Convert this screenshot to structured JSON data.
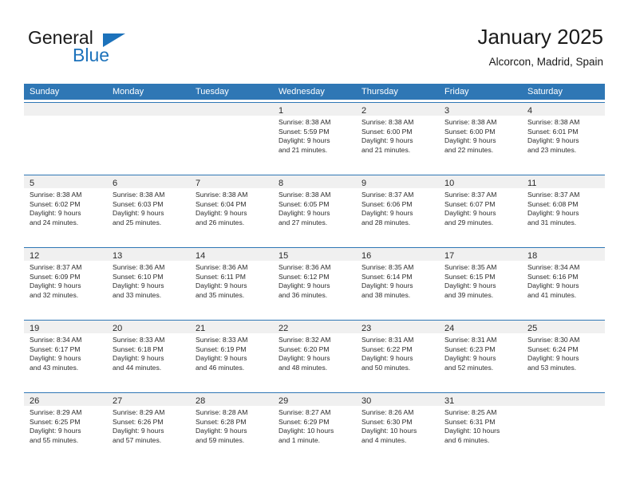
{
  "brand": {
    "word_one": "General",
    "word_two": "Blue",
    "flag_icon": "triangle-flag-icon"
  },
  "header": {
    "title": "January 2025",
    "location": "Alcorcon, Madrid, Spain"
  },
  "colors": {
    "header_blue": "#2f77b5",
    "brand_blue": "#1c72bb",
    "daynum_band": "#f0f0f0",
    "text": "#2b2b2b"
  },
  "calendar": {
    "day_headers": [
      "Sunday",
      "Monday",
      "Tuesday",
      "Wednesday",
      "Thursday",
      "Friday",
      "Saturday"
    ],
    "weeks": [
      [
        {
          "empty": true
        },
        {
          "empty": true
        },
        {
          "empty": true
        },
        {
          "day": "1",
          "sunrise": "Sunrise: 8:38 AM",
          "sunset": "Sunset: 5:59 PM",
          "daylight1": "Daylight: 9 hours",
          "daylight2": "and 21 minutes."
        },
        {
          "day": "2",
          "sunrise": "Sunrise: 8:38 AM",
          "sunset": "Sunset: 6:00 PM",
          "daylight1": "Daylight: 9 hours",
          "daylight2": "and 21 minutes."
        },
        {
          "day": "3",
          "sunrise": "Sunrise: 8:38 AM",
          "sunset": "Sunset: 6:00 PM",
          "daylight1": "Daylight: 9 hours",
          "daylight2": "and 22 minutes."
        },
        {
          "day": "4",
          "sunrise": "Sunrise: 8:38 AM",
          "sunset": "Sunset: 6:01 PM",
          "daylight1": "Daylight: 9 hours",
          "daylight2": "and 23 minutes."
        }
      ],
      [
        {
          "day": "5",
          "sunrise": "Sunrise: 8:38 AM",
          "sunset": "Sunset: 6:02 PM",
          "daylight1": "Daylight: 9 hours",
          "daylight2": "and 24 minutes."
        },
        {
          "day": "6",
          "sunrise": "Sunrise: 8:38 AM",
          "sunset": "Sunset: 6:03 PM",
          "daylight1": "Daylight: 9 hours",
          "daylight2": "and 25 minutes."
        },
        {
          "day": "7",
          "sunrise": "Sunrise: 8:38 AM",
          "sunset": "Sunset: 6:04 PM",
          "daylight1": "Daylight: 9 hours",
          "daylight2": "and 26 minutes."
        },
        {
          "day": "8",
          "sunrise": "Sunrise: 8:38 AM",
          "sunset": "Sunset: 6:05 PM",
          "daylight1": "Daylight: 9 hours",
          "daylight2": "and 27 minutes."
        },
        {
          "day": "9",
          "sunrise": "Sunrise: 8:37 AM",
          "sunset": "Sunset: 6:06 PM",
          "daylight1": "Daylight: 9 hours",
          "daylight2": "and 28 minutes."
        },
        {
          "day": "10",
          "sunrise": "Sunrise: 8:37 AM",
          "sunset": "Sunset: 6:07 PM",
          "daylight1": "Daylight: 9 hours",
          "daylight2": "and 29 minutes."
        },
        {
          "day": "11",
          "sunrise": "Sunrise: 8:37 AM",
          "sunset": "Sunset: 6:08 PM",
          "daylight1": "Daylight: 9 hours",
          "daylight2": "and 31 minutes."
        }
      ],
      [
        {
          "day": "12",
          "sunrise": "Sunrise: 8:37 AM",
          "sunset": "Sunset: 6:09 PM",
          "daylight1": "Daylight: 9 hours",
          "daylight2": "and 32 minutes."
        },
        {
          "day": "13",
          "sunrise": "Sunrise: 8:36 AM",
          "sunset": "Sunset: 6:10 PM",
          "daylight1": "Daylight: 9 hours",
          "daylight2": "and 33 minutes."
        },
        {
          "day": "14",
          "sunrise": "Sunrise: 8:36 AM",
          "sunset": "Sunset: 6:11 PM",
          "daylight1": "Daylight: 9 hours",
          "daylight2": "and 35 minutes."
        },
        {
          "day": "15",
          "sunrise": "Sunrise: 8:36 AM",
          "sunset": "Sunset: 6:12 PM",
          "daylight1": "Daylight: 9 hours",
          "daylight2": "and 36 minutes."
        },
        {
          "day": "16",
          "sunrise": "Sunrise: 8:35 AM",
          "sunset": "Sunset: 6:14 PM",
          "daylight1": "Daylight: 9 hours",
          "daylight2": "and 38 minutes."
        },
        {
          "day": "17",
          "sunrise": "Sunrise: 8:35 AM",
          "sunset": "Sunset: 6:15 PM",
          "daylight1": "Daylight: 9 hours",
          "daylight2": "and 39 minutes."
        },
        {
          "day": "18",
          "sunrise": "Sunrise: 8:34 AM",
          "sunset": "Sunset: 6:16 PM",
          "daylight1": "Daylight: 9 hours",
          "daylight2": "and 41 minutes."
        }
      ],
      [
        {
          "day": "19",
          "sunrise": "Sunrise: 8:34 AM",
          "sunset": "Sunset: 6:17 PM",
          "daylight1": "Daylight: 9 hours",
          "daylight2": "and 43 minutes."
        },
        {
          "day": "20",
          "sunrise": "Sunrise: 8:33 AM",
          "sunset": "Sunset: 6:18 PM",
          "daylight1": "Daylight: 9 hours",
          "daylight2": "and 44 minutes."
        },
        {
          "day": "21",
          "sunrise": "Sunrise: 8:33 AM",
          "sunset": "Sunset: 6:19 PM",
          "daylight1": "Daylight: 9 hours",
          "daylight2": "and 46 minutes."
        },
        {
          "day": "22",
          "sunrise": "Sunrise: 8:32 AM",
          "sunset": "Sunset: 6:20 PM",
          "daylight1": "Daylight: 9 hours",
          "daylight2": "and 48 minutes."
        },
        {
          "day": "23",
          "sunrise": "Sunrise: 8:31 AM",
          "sunset": "Sunset: 6:22 PM",
          "daylight1": "Daylight: 9 hours",
          "daylight2": "and 50 minutes."
        },
        {
          "day": "24",
          "sunrise": "Sunrise: 8:31 AM",
          "sunset": "Sunset: 6:23 PM",
          "daylight1": "Daylight: 9 hours",
          "daylight2": "and 52 minutes."
        },
        {
          "day": "25",
          "sunrise": "Sunrise: 8:30 AM",
          "sunset": "Sunset: 6:24 PM",
          "daylight1": "Daylight: 9 hours",
          "daylight2": "and 53 minutes."
        }
      ],
      [
        {
          "day": "26",
          "sunrise": "Sunrise: 8:29 AM",
          "sunset": "Sunset: 6:25 PM",
          "daylight1": "Daylight: 9 hours",
          "daylight2": "and 55 minutes."
        },
        {
          "day": "27",
          "sunrise": "Sunrise: 8:29 AM",
          "sunset": "Sunset: 6:26 PM",
          "daylight1": "Daylight: 9 hours",
          "daylight2": "and 57 minutes."
        },
        {
          "day": "28",
          "sunrise": "Sunrise: 8:28 AM",
          "sunset": "Sunset: 6:28 PM",
          "daylight1": "Daylight: 9 hours",
          "daylight2": "and 59 minutes."
        },
        {
          "day": "29",
          "sunrise": "Sunrise: 8:27 AM",
          "sunset": "Sunset: 6:29 PM",
          "daylight1": "Daylight: 10 hours",
          "daylight2": "and 1 minute."
        },
        {
          "day": "30",
          "sunrise": "Sunrise: 8:26 AM",
          "sunset": "Sunset: 6:30 PM",
          "daylight1": "Daylight: 10 hours",
          "daylight2": "and 4 minutes."
        },
        {
          "day": "31",
          "sunrise": "Sunrise: 8:25 AM",
          "sunset": "Sunset: 6:31 PM",
          "daylight1": "Daylight: 10 hours",
          "daylight2": "and 6 minutes."
        },
        {
          "empty": true
        }
      ]
    ]
  }
}
